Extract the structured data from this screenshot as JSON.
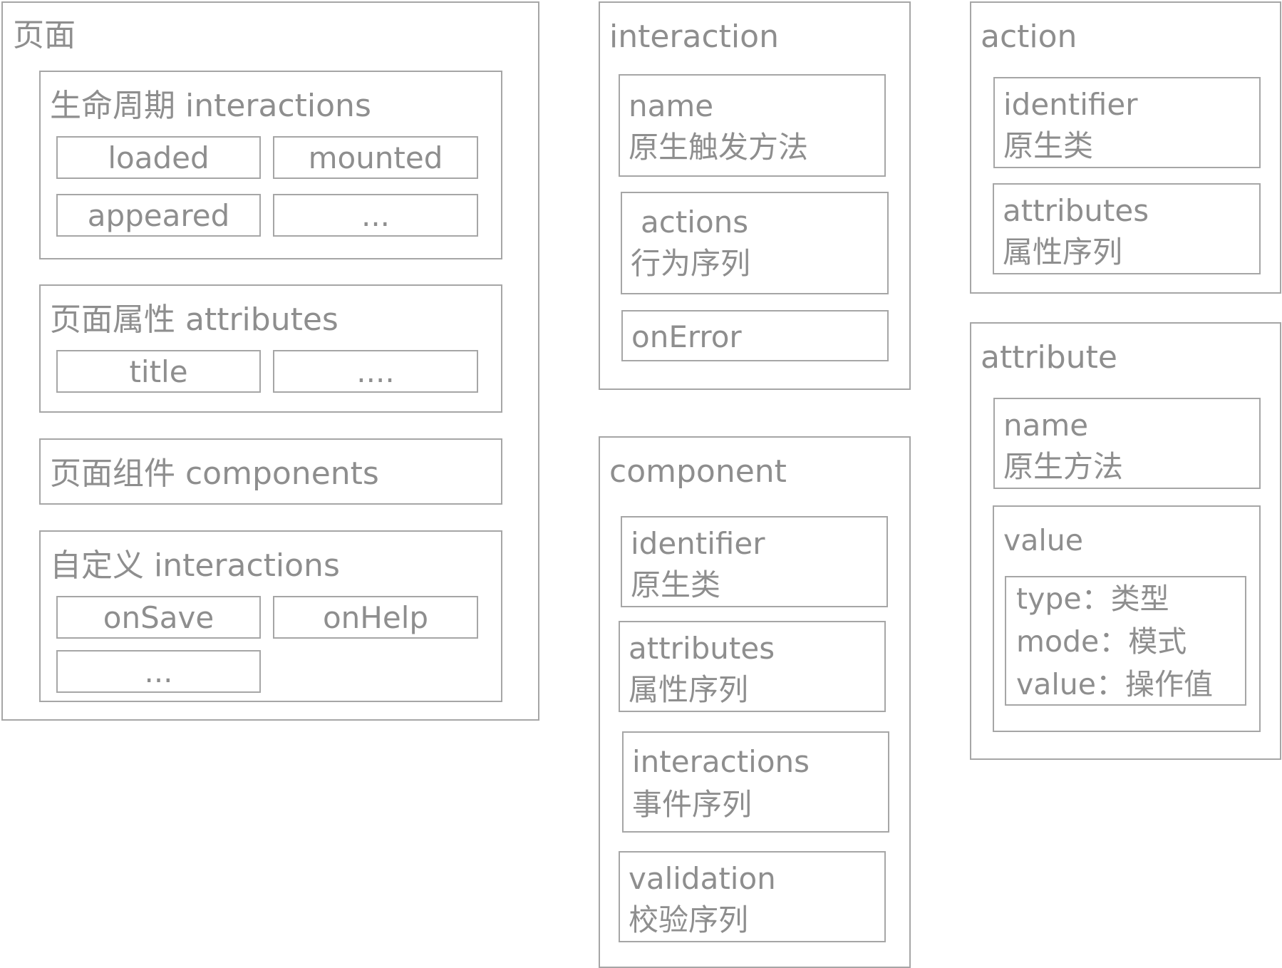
{
  "page": {
    "title": "页面",
    "lifecycle": {
      "title": "生命周期 interactions",
      "items": [
        "loaded",
        "mounted",
        "appeared",
        "..."
      ]
    },
    "attributes": {
      "title": "页面属性 attributes",
      "items": [
        "title",
        "...."
      ]
    },
    "components": {
      "title": "页面组件 components"
    },
    "custom": {
      "title": "自定义 interactions",
      "items": [
        "onSave",
        "onHelp",
        "..."
      ]
    }
  },
  "interaction": {
    "title": "interaction",
    "name": {
      "key": "name",
      "desc": "原生触发方法"
    },
    "actions": {
      "key": "actions",
      "desc": "行为序列"
    },
    "onError": {
      "key": "onError"
    }
  },
  "component": {
    "title": "component",
    "identifier": {
      "key": "identifier",
      "desc": "原生类"
    },
    "attributes": {
      "key": "attributes",
      "desc": "属性序列"
    },
    "interactions": {
      "key": "interactions",
      "desc": "事件序列"
    },
    "validation": {
      "key": "validation",
      "desc": "校验序列"
    }
  },
  "action": {
    "title": "action",
    "identifier": {
      "key": "identifier",
      "desc": "原生类"
    },
    "attributes": {
      "key": "attributes",
      "desc": "属性序列"
    }
  },
  "attribute": {
    "title": "attribute",
    "name": {
      "key": "name",
      "desc": "原生方法"
    },
    "value": {
      "key": "value",
      "fields": [
        "type：类型",
        "mode：模式",
        "value：操作值"
      ]
    }
  }
}
